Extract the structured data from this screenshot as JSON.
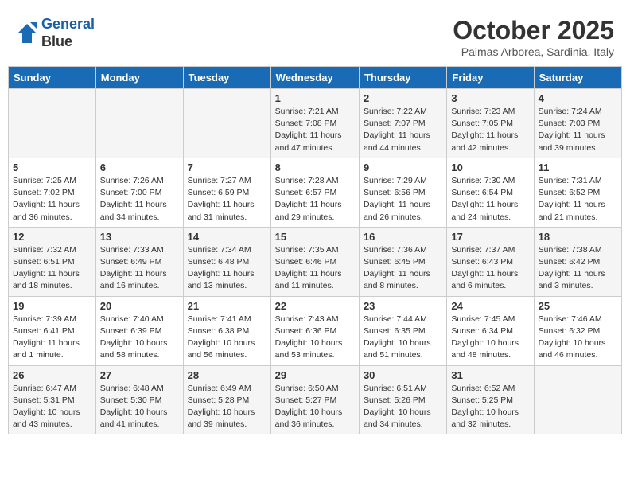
{
  "header": {
    "logo_line1": "General",
    "logo_line2": "Blue",
    "month": "October 2025",
    "location": "Palmas Arborea, Sardinia, Italy"
  },
  "weekdays": [
    "Sunday",
    "Monday",
    "Tuesday",
    "Wednesday",
    "Thursday",
    "Friday",
    "Saturday"
  ],
  "weeks": [
    [
      {
        "day": "",
        "info": ""
      },
      {
        "day": "",
        "info": ""
      },
      {
        "day": "",
        "info": ""
      },
      {
        "day": "1",
        "info": "Sunrise: 7:21 AM\nSunset: 7:08 PM\nDaylight: 11 hours and 47 minutes."
      },
      {
        "day": "2",
        "info": "Sunrise: 7:22 AM\nSunset: 7:07 PM\nDaylight: 11 hours and 44 minutes."
      },
      {
        "day": "3",
        "info": "Sunrise: 7:23 AM\nSunset: 7:05 PM\nDaylight: 11 hours and 42 minutes."
      },
      {
        "day": "4",
        "info": "Sunrise: 7:24 AM\nSunset: 7:03 PM\nDaylight: 11 hours and 39 minutes."
      }
    ],
    [
      {
        "day": "5",
        "info": "Sunrise: 7:25 AM\nSunset: 7:02 PM\nDaylight: 11 hours and 36 minutes."
      },
      {
        "day": "6",
        "info": "Sunrise: 7:26 AM\nSunset: 7:00 PM\nDaylight: 11 hours and 34 minutes."
      },
      {
        "day": "7",
        "info": "Sunrise: 7:27 AM\nSunset: 6:59 PM\nDaylight: 11 hours and 31 minutes."
      },
      {
        "day": "8",
        "info": "Sunrise: 7:28 AM\nSunset: 6:57 PM\nDaylight: 11 hours and 29 minutes."
      },
      {
        "day": "9",
        "info": "Sunrise: 7:29 AM\nSunset: 6:56 PM\nDaylight: 11 hours and 26 minutes."
      },
      {
        "day": "10",
        "info": "Sunrise: 7:30 AM\nSunset: 6:54 PM\nDaylight: 11 hours and 24 minutes."
      },
      {
        "day": "11",
        "info": "Sunrise: 7:31 AM\nSunset: 6:52 PM\nDaylight: 11 hours and 21 minutes."
      }
    ],
    [
      {
        "day": "12",
        "info": "Sunrise: 7:32 AM\nSunset: 6:51 PM\nDaylight: 11 hours and 18 minutes."
      },
      {
        "day": "13",
        "info": "Sunrise: 7:33 AM\nSunset: 6:49 PM\nDaylight: 11 hours and 16 minutes."
      },
      {
        "day": "14",
        "info": "Sunrise: 7:34 AM\nSunset: 6:48 PM\nDaylight: 11 hours and 13 minutes."
      },
      {
        "day": "15",
        "info": "Sunrise: 7:35 AM\nSunset: 6:46 PM\nDaylight: 11 hours and 11 minutes."
      },
      {
        "day": "16",
        "info": "Sunrise: 7:36 AM\nSunset: 6:45 PM\nDaylight: 11 hours and 8 minutes."
      },
      {
        "day": "17",
        "info": "Sunrise: 7:37 AM\nSunset: 6:43 PM\nDaylight: 11 hours and 6 minutes."
      },
      {
        "day": "18",
        "info": "Sunrise: 7:38 AM\nSunset: 6:42 PM\nDaylight: 11 hours and 3 minutes."
      }
    ],
    [
      {
        "day": "19",
        "info": "Sunrise: 7:39 AM\nSunset: 6:41 PM\nDaylight: 11 hours and 1 minute."
      },
      {
        "day": "20",
        "info": "Sunrise: 7:40 AM\nSunset: 6:39 PM\nDaylight: 10 hours and 58 minutes."
      },
      {
        "day": "21",
        "info": "Sunrise: 7:41 AM\nSunset: 6:38 PM\nDaylight: 10 hours and 56 minutes."
      },
      {
        "day": "22",
        "info": "Sunrise: 7:43 AM\nSunset: 6:36 PM\nDaylight: 10 hours and 53 minutes."
      },
      {
        "day": "23",
        "info": "Sunrise: 7:44 AM\nSunset: 6:35 PM\nDaylight: 10 hours and 51 minutes."
      },
      {
        "day": "24",
        "info": "Sunrise: 7:45 AM\nSunset: 6:34 PM\nDaylight: 10 hours and 48 minutes."
      },
      {
        "day": "25",
        "info": "Sunrise: 7:46 AM\nSunset: 6:32 PM\nDaylight: 10 hours and 46 minutes."
      }
    ],
    [
      {
        "day": "26",
        "info": "Sunrise: 6:47 AM\nSunset: 5:31 PM\nDaylight: 10 hours and 43 minutes."
      },
      {
        "day": "27",
        "info": "Sunrise: 6:48 AM\nSunset: 5:30 PM\nDaylight: 10 hours and 41 minutes."
      },
      {
        "day": "28",
        "info": "Sunrise: 6:49 AM\nSunset: 5:28 PM\nDaylight: 10 hours and 39 minutes."
      },
      {
        "day": "29",
        "info": "Sunrise: 6:50 AM\nSunset: 5:27 PM\nDaylight: 10 hours and 36 minutes."
      },
      {
        "day": "30",
        "info": "Sunrise: 6:51 AM\nSunset: 5:26 PM\nDaylight: 10 hours and 34 minutes."
      },
      {
        "day": "31",
        "info": "Sunrise: 6:52 AM\nSunset: 5:25 PM\nDaylight: 10 hours and 32 minutes."
      },
      {
        "day": "",
        "info": ""
      }
    ]
  ]
}
